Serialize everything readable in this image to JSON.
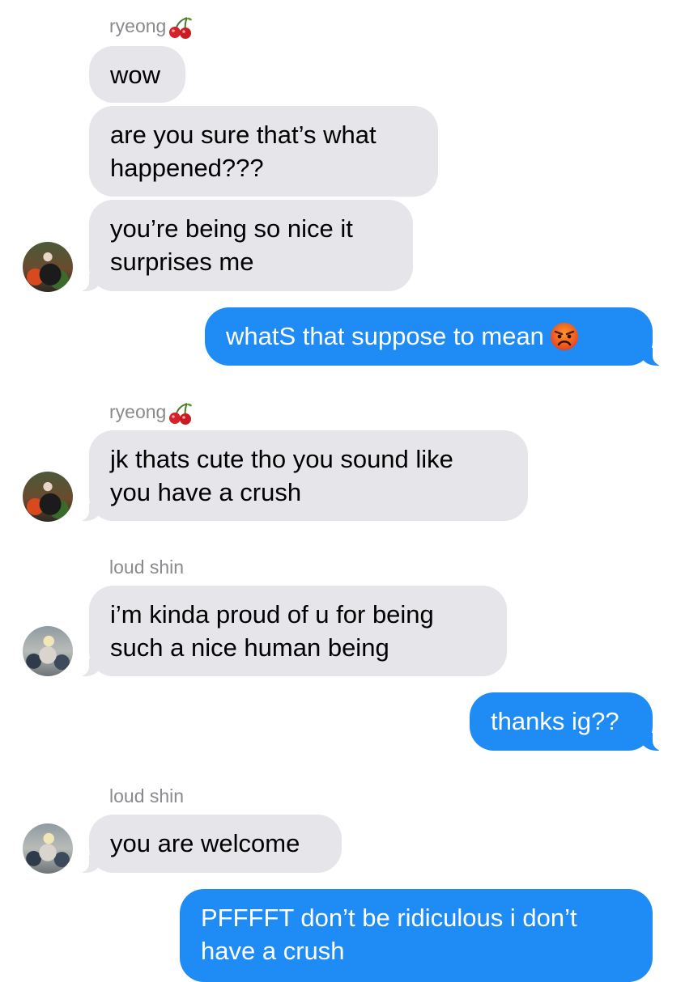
{
  "conversation": {
    "sender_ryeong": "ryeong",
    "sender_shin": "loud shin",
    "messages": {
      "m1": "wow",
      "m2": "are you sure that’s what\nhappened???",
      "m3": "you’re being so nice it\nsurprises me",
      "m4": "whatS that suppose to mean",
      "m5": "jk thats cute tho you sound like\nyou have a crush",
      "m6": "i’m kinda proud of u for being\nsuch a nice human being",
      "m7": "thanks ig??",
      "m8": "you are welcome",
      "m9": "PFFFFT don’t be ridiculous i don’t\nhave a crush"
    }
  },
  "colors": {
    "incoming_bubble": "#e5e5ea",
    "outgoing_bubble": "#1f8bf5",
    "sender_name": "#8a8a8f"
  },
  "icons": {
    "name_suffix": "cherry-icon",
    "emoji": "angry-face-icon"
  }
}
